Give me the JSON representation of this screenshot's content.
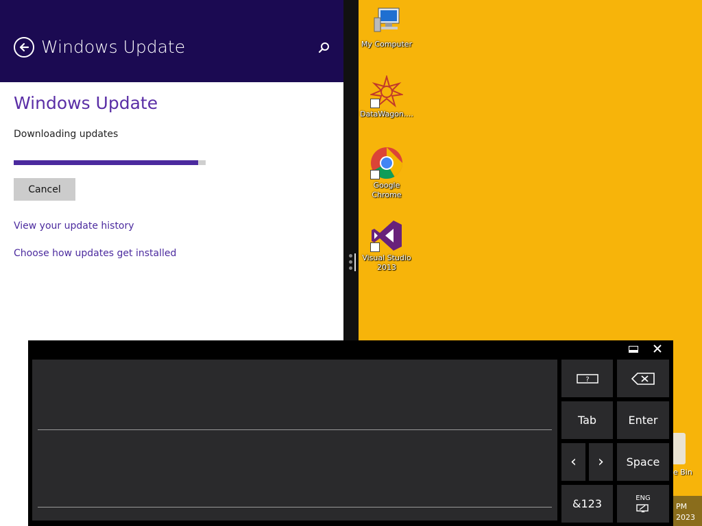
{
  "panel": {
    "header_title": "Windows Update",
    "section_title": "Windows Update",
    "status": "Downloading updates",
    "progress_fraction": 0.96,
    "cancel_label": "Cancel",
    "links": {
      "history": "View your update history",
      "choose": "Choose how updates get installed"
    },
    "colors": {
      "header_bg": "#1b0a52",
      "accent": "#4b2a9e"
    }
  },
  "desktop": {
    "background": "#f7b40a",
    "icons": [
      {
        "label": "My Computer",
        "icon": "computer-icon"
      },
      {
        "label": "DataWagon....",
        "icon": "datawagon-icon"
      },
      {
        "label": "Google Chrome",
        "icon": "chrome-icon"
      },
      {
        "label": "Visual Studio 2013",
        "icon": "visual-studio-icon"
      }
    ],
    "recycle_label": "e Bin",
    "tray": {
      "time": "PM",
      "date": "2023"
    }
  },
  "keyboard": {
    "keys": {
      "help": "?",
      "tab": "Tab",
      "enter": "Enter",
      "left": "‹",
      "right": "›",
      "space": "Space",
      "symbols": "&123",
      "lang": "ENG"
    }
  }
}
